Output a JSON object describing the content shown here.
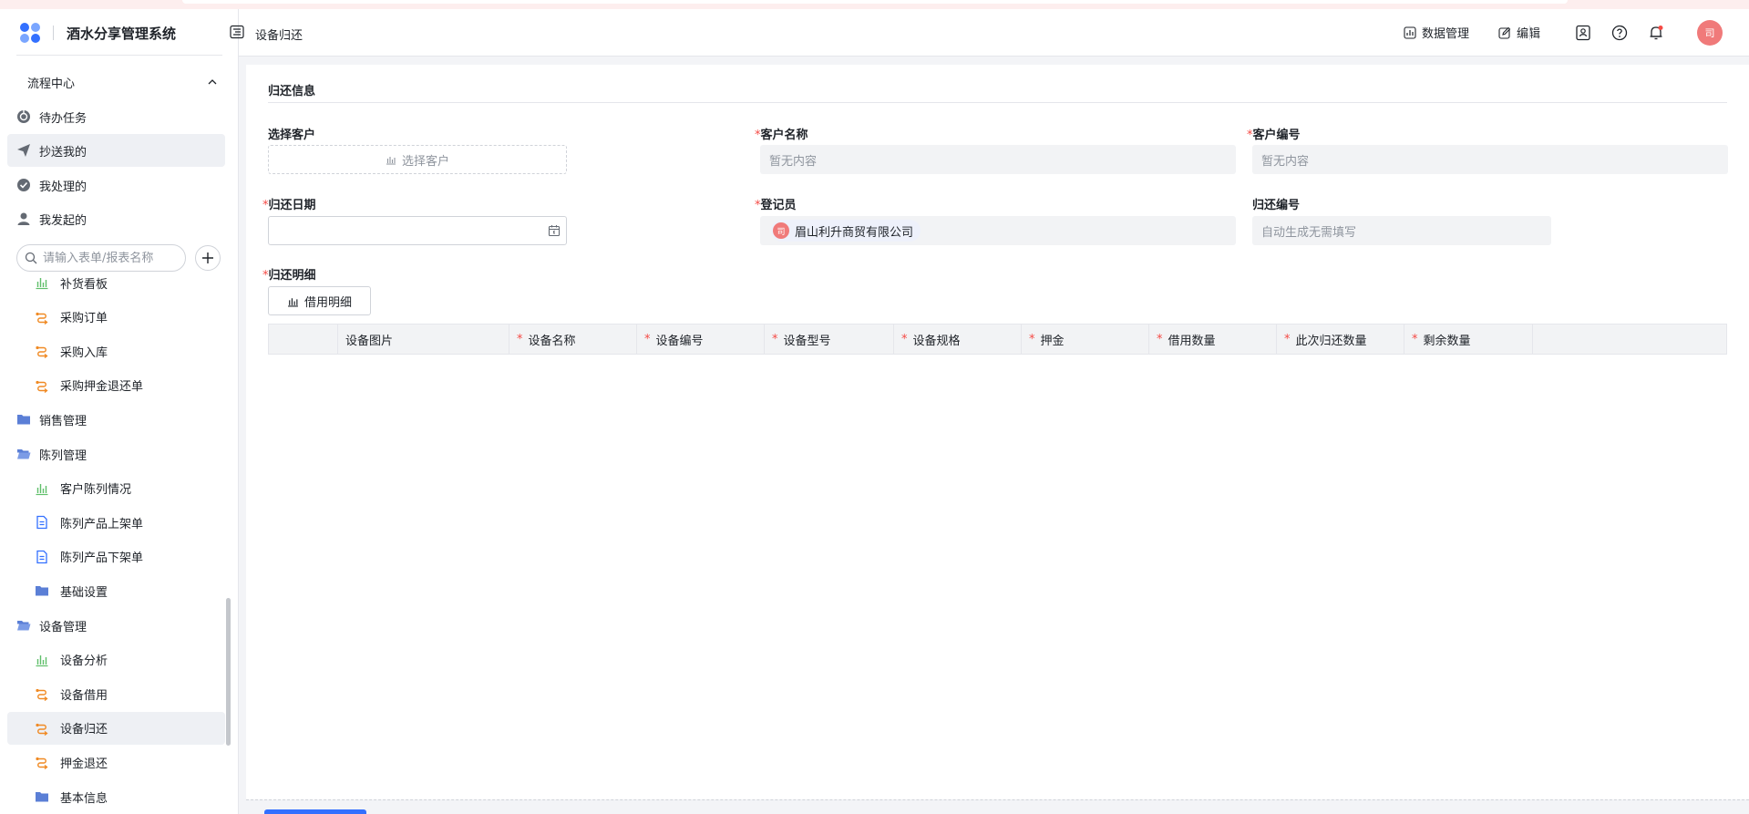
{
  "app": {
    "title": "酒水分享管理系统"
  },
  "header": {
    "page_title": "设备归还",
    "data_manage": "数据管理",
    "edit": "编辑",
    "avatar_text": "司"
  },
  "sidebar": {
    "flow_center": "流程中心",
    "flow_items": [
      "待办任务",
      "抄送我的",
      "我处理的",
      "我发起的"
    ],
    "search_placeholder": "请输入表单/报表名称",
    "items": [
      {
        "label": "补货看板",
        "icon": "bar-chart-icon",
        "level": "sub"
      },
      {
        "label": "采购订单",
        "icon": "flow-icon",
        "level": "sub"
      },
      {
        "label": "采购入库",
        "icon": "flow-icon",
        "level": "sub"
      },
      {
        "label": "采购押金退还单",
        "icon": "flow-icon",
        "level": "sub"
      },
      {
        "label": "销售管理",
        "icon": "folder-icon",
        "level": "top"
      },
      {
        "label": "陈列管理",
        "icon": "folder-open-icon",
        "level": "top"
      },
      {
        "label": "客户陈列情况",
        "icon": "bar-chart-icon",
        "level": "sub"
      },
      {
        "label": "陈列产品上架单",
        "icon": "doc-icon",
        "level": "sub"
      },
      {
        "label": "陈列产品下架单",
        "icon": "doc-icon",
        "level": "sub"
      },
      {
        "label": "基础设置",
        "icon": "folder-icon",
        "level": "sub"
      },
      {
        "label": "设备管理",
        "icon": "folder-open-icon",
        "level": "top"
      },
      {
        "label": "设备分析",
        "icon": "bar-chart-icon",
        "level": "sub"
      },
      {
        "label": "设备借用",
        "icon": "flow-icon",
        "level": "sub"
      },
      {
        "label": "设备归还",
        "icon": "flow-icon",
        "level": "sub"
      },
      {
        "label": "押金退还",
        "icon": "flow-icon",
        "level": "sub"
      },
      {
        "label": "基本信息",
        "icon": "folder-icon",
        "level": "sub"
      }
    ]
  },
  "form": {
    "section_title": "归还信息",
    "select_customer_label": "选择客户",
    "select_customer_btn": "选择客户",
    "customer_name_label": "客户名称",
    "customer_name_value": "暂无内容",
    "customer_code_label": "客户编号",
    "customer_code_value": "暂无内容",
    "return_date_label": "归还日期",
    "registrar_label": "登记员",
    "registrar_avatar": "司",
    "registrar_value": "眉山利升商贸有限公司",
    "return_no_label": "归还编号",
    "return_no_placeholder": "自动生成无需填写",
    "detail_label": "归还明细",
    "borrow_detail_btn": "借用明细",
    "required_mark": "*",
    "table_headers": [
      {
        "label": "",
        "required": false
      },
      {
        "label": "设备图片",
        "required": false
      },
      {
        "label": "设备名称",
        "required": true
      },
      {
        "label": "设备编号",
        "required": true
      },
      {
        "label": "设备型号",
        "required": true
      },
      {
        "label": "设备规格",
        "required": true
      },
      {
        "label": "押金",
        "required": true
      },
      {
        "label": "借用数量",
        "required": true
      },
      {
        "label": "此次归还数量",
        "required": true
      },
      {
        "label": "剩余数量",
        "required": true
      },
      {
        "label": "",
        "required": false
      }
    ]
  },
  "colors": {
    "accent": "#3370ff",
    "required": "#f54a45",
    "avatar": "#f07a7a",
    "flow_icon": "#f08a24",
    "chart_icon": "#5fbf6a",
    "folder_icon": "#5b7fd6"
  }
}
